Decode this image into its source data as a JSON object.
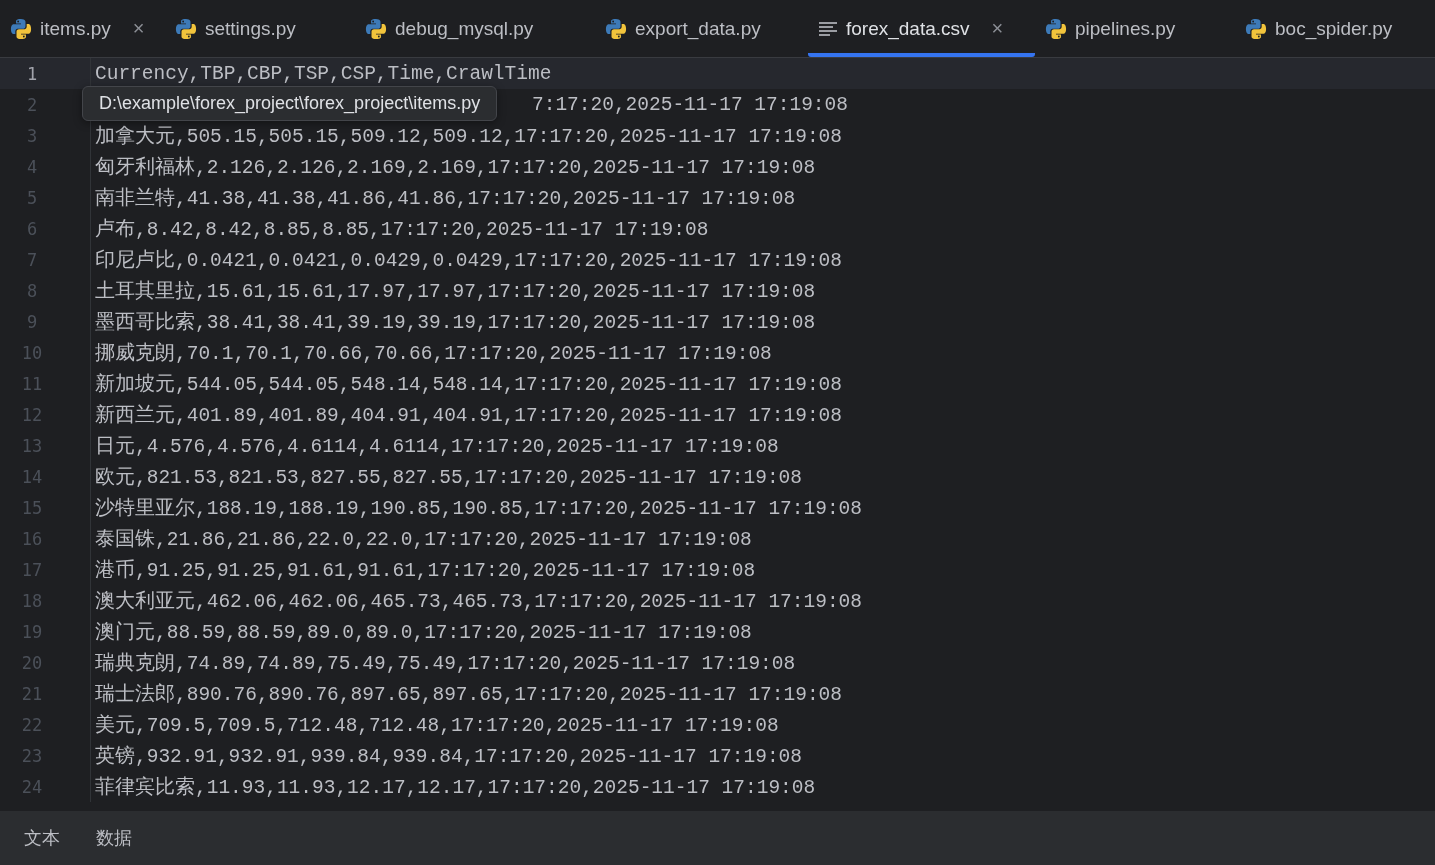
{
  "tabs": [
    {
      "label": "items.py",
      "kind": "python",
      "selected": false,
      "close": "×"
    },
    {
      "label": "settings.py",
      "kind": "python",
      "selected": false
    },
    {
      "label": "debug_mysql.py",
      "kind": "python",
      "selected": false
    },
    {
      "label": "export_data.py",
      "kind": "python",
      "selected": false
    },
    {
      "label": "forex_data.csv",
      "kind": "text",
      "selected": true,
      "close": "×"
    },
    {
      "label": "pipelines.py",
      "kind": "python",
      "selected": false
    },
    {
      "label": "boc_spider.py",
      "kind": "python",
      "selected": false
    }
  ],
  "editor": {
    "lines": [
      {
        "number": "1",
        "text": "Currency,TBP,CBP,TSP,CSP,Time,CrawlTime",
        "current": true
      },
      {
        "number": "2",
        "text": "7:17:20,2025-11-17 17:19:08",
        "current": false,
        "kind": "covered"
      },
      {
        "number": "3",
        "text": "加拿大元,505.15,505.15,509.12,509.12,17:17:20,2025-11-17 17:19:08",
        "current": false
      },
      {
        "number": "4",
        "text": "匈牙利福林,2.126,2.126,2.169,2.169,17:17:20,2025-11-17 17:19:08",
        "current": false
      },
      {
        "number": "5",
        "text": "南非兰特,41.38,41.38,41.86,41.86,17:17:20,2025-11-17 17:19:08",
        "current": false
      },
      {
        "number": "6",
        "text": "卢布,8.42,8.42,8.85,8.85,17:17:20,2025-11-17 17:19:08",
        "current": false
      },
      {
        "number": "7",
        "text": "印尼卢比,0.0421,0.0421,0.0429,0.0429,17:17:20,2025-11-17 17:19:08",
        "current": false
      },
      {
        "number": "8",
        "text": "土耳其里拉,15.61,15.61,17.97,17.97,17:17:20,2025-11-17 17:19:08",
        "current": false
      },
      {
        "number": "9",
        "text": "墨西哥比索,38.41,38.41,39.19,39.19,17:17:20,2025-11-17 17:19:08",
        "current": false
      },
      {
        "number": "10",
        "text": "挪威克朗,70.1,70.1,70.66,70.66,17:17:20,2025-11-17 17:19:08",
        "current": false
      },
      {
        "number": "11",
        "text": "新加坡元,544.05,544.05,548.14,548.14,17:17:20,2025-11-17 17:19:08",
        "current": false
      },
      {
        "number": "12",
        "text": "新西兰元,401.89,401.89,404.91,404.91,17:17:20,2025-11-17 17:19:08",
        "current": false
      },
      {
        "number": "13",
        "text": "日元,4.576,4.576,4.6114,4.6114,17:17:20,2025-11-17 17:19:08",
        "current": false
      },
      {
        "number": "14",
        "text": "欧元,821.53,821.53,827.55,827.55,17:17:20,2025-11-17 17:19:08",
        "current": false
      },
      {
        "number": "15",
        "text": "沙特里亚尔,188.19,188.19,190.85,190.85,17:17:20,2025-11-17 17:19:08",
        "current": false
      },
      {
        "number": "16",
        "text": "泰国铢,21.86,21.86,22.0,22.0,17:17:20,2025-11-17 17:19:08",
        "current": false
      },
      {
        "number": "17",
        "text": "港币,91.25,91.25,91.61,91.61,17:17:20,2025-11-17 17:19:08",
        "current": false
      },
      {
        "number": "18",
        "text": "澳大利亚元,462.06,462.06,465.73,465.73,17:17:20,2025-11-17 17:19:08",
        "current": false
      },
      {
        "number": "19",
        "text": "澳门元,88.59,88.59,89.0,89.0,17:17:20,2025-11-17 17:19:08",
        "current": false
      },
      {
        "number": "20",
        "text": "瑞典克朗,74.89,74.89,75.49,75.49,17:17:20,2025-11-17 17:19:08",
        "current": false
      },
      {
        "number": "21",
        "text": "瑞士法郎,890.76,890.76,897.65,897.65,17:17:20,2025-11-17 17:19:08",
        "current": false
      },
      {
        "number": "22",
        "text": "美元,709.5,709.5,712.48,712.48,17:17:20,2025-11-17 17:19:08",
        "current": false
      },
      {
        "number": "23",
        "text": "英镑,932.91,932.91,939.84,939.84,17:17:20,2025-11-17 17:19:08",
        "current": false
      },
      {
        "number": "24",
        "text": "菲律宾比索,11.93,11.93,12.17,12.17,17:17:20,2025-11-17 17:19:08",
        "current": false
      }
    ]
  },
  "tooltip": {
    "text": "D:\\example\\forex_project\\forex_project\\items.py"
  },
  "bottom_tabs": [
    {
      "label": "文本",
      "selected": false
    },
    {
      "label": "数据",
      "selected": false
    }
  ]
}
